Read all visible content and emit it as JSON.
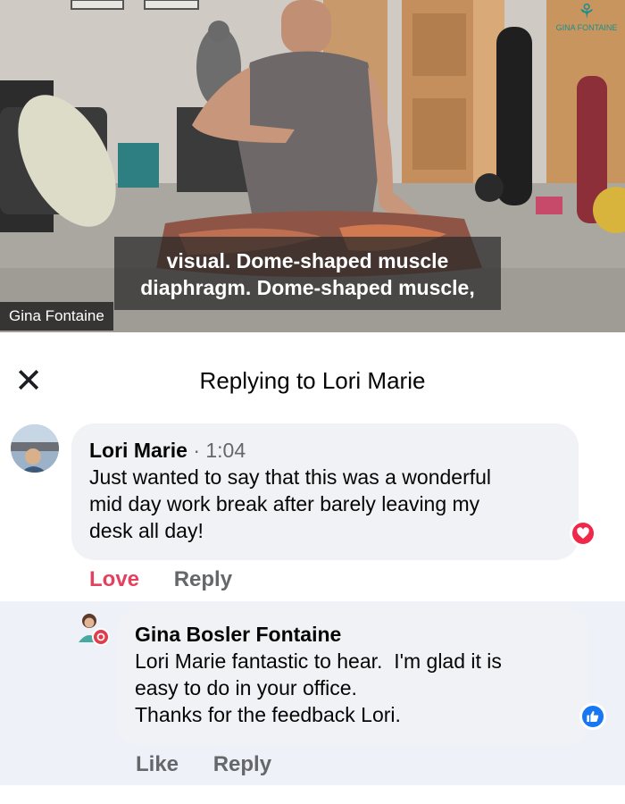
{
  "video": {
    "caption_lines": [
      "visual. Dome-shaped muscle",
      "diaphragm. Dome-shaped muscle,"
    ],
    "presenter_name": "Gina Fontaine",
    "watermark": "GINA FONTAINE"
  },
  "panel": {
    "title": "Replying to Lori Marie",
    "close_glyph": "✕"
  },
  "comments": [
    {
      "author": "Lori Marie",
      "time": "1:04",
      "separator": "·",
      "lines": [
        "Just wanted to say that this was a wonderful",
        "mid day work break after barely leaving my",
        "desk all day!"
      ],
      "reaction": "heart-icon",
      "actions": {
        "reaction_label": "Love",
        "reply_label": "Reply"
      }
    },
    {
      "author": "Gina Bosler Fontaine",
      "lines": [
        "Lori Marie fantastic to hear.  I'm glad it is",
        "easy to do in your office.",
        "Thanks for the feedback Lori."
      ],
      "reaction": "thumbs-up-icon",
      "actions": {
        "reaction_label": "Like",
        "reply_label": "Reply"
      }
    }
  ],
  "colors": {
    "love": "#e4405f",
    "like": "#1877f2",
    "bubble": "#f0f2f5",
    "reply_background": "#eef2f8"
  }
}
